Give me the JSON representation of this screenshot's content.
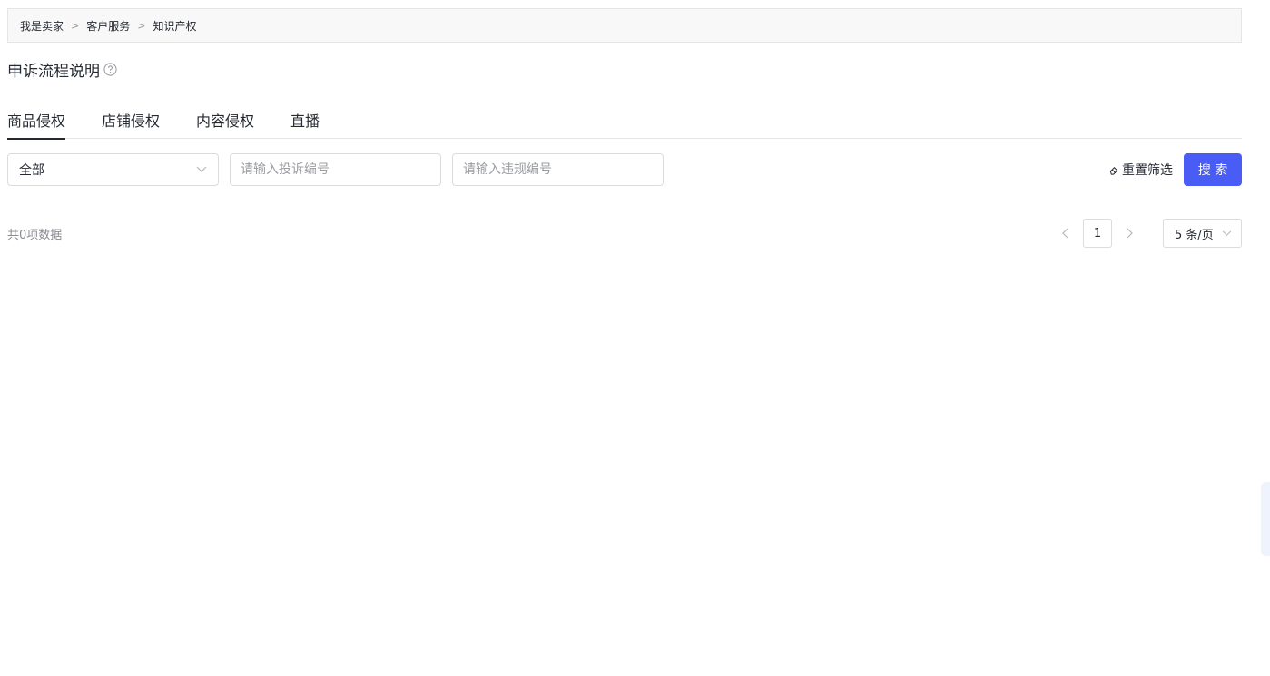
{
  "breadcrumb": {
    "items": [
      "我是卖家",
      "客户服务",
      "知识产权"
    ],
    "separator": ">"
  },
  "page": {
    "title": "申诉流程说明"
  },
  "tabs": [
    {
      "label": "商品侵权",
      "active": true
    },
    {
      "label": "店铺侵权",
      "active": false
    },
    {
      "label": "内容侵权",
      "active": false
    },
    {
      "label": "直播",
      "active": false
    }
  ],
  "filters": {
    "type_select": {
      "value": "全部"
    },
    "complaint_input": {
      "placeholder": "请输入投诉编号",
      "value": ""
    },
    "violation_input": {
      "placeholder": "请输入违规编号",
      "value": ""
    },
    "reset_label": "重置筛选",
    "search_label": "搜 索"
  },
  "results": {
    "count_text": "共0项数据"
  },
  "pagination": {
    "current_page": "1",
    "page_size": "5 条/页"
  },
  "colors": {
    "accent": "#4a5cf6",
    "text": "#252931",
    "muted": "#8a8c92",
    "border": "#dcdcdc"
  }
}
